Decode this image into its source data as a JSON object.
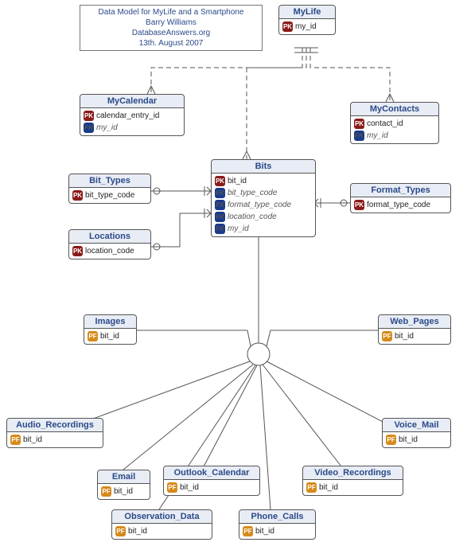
{
  "title": {
    "line1": "Data Model for MyLife and a Smartphone",
    "line2": "Barry Williams",
    "line3": "DatabaseAnswers.org",
    "line4": "13th. August 2007"
  },
  "entities": {
    "MyLife": {
      "name": "MyLife",
      "attrs": [
        {
          "k": "pk",
          "n": "my_id"
        }
      ]
    },
    "MyCalendar": {
      "name": "MyCalendar",
      "attrs": [
        {
          "k": "pk",
          "n": "calendar_entry_id"
        },
        {
          "k": "fk",
          "n": "my_id"
        }
      ]
    },
    "MyContacts": {
      "name": "MyContacts",
      "attrs": [
        {
          "k": "pk",
          "n": "contact_id"
        },
        {
          "k": "fk",
          "n": "my_id"
        }
      ]
    },
    "Bits": {
      "name": "Bits",
      "attrs": [
        {
          "k": "pk",
          "n": "bit_id"
        },
        {
          "k": "fk",
          "n": "bit_type_code"
        },
        {
          "k": "fk",
          "n": "format_type_code"
        },
        {
          "k": "fk",
          "n": "location_code"
        },
        {
          "k": "fk",
          "n": "my_id"
        }
      ]
    },
    "Bit_Types": {
      "name": "Bit_Types",
      "attrs": [
        {
          "k": "pk",
          "n": "bit_type_code"
        }
      ]
    },
    "Format_Types": {
      "name": "Format_Types",
      "attrs": [
        {
          "k": "pk",
          "n": "format_type_code"
        }
      ]
    },
    "Locations": {
      "name": "Locations",
      "attrs": [
        {
          "k": "pk",
          "n": "location_code"
        }
      ]
    },
    "Images": {
      "name": "Images",
      "attrs": [
        {
          "k": "pf",
          "n": "bit_id"
        }
      ]
    },
    "Web_Pages": {
      "name": "Web_Pages",
      "attrs": [
        {
          "k": "pf",
          "n": "bit_id"
        }
      ]
    },
    "Audio_Recordings": {
      "name": "Audio_Recordings",
      "attrs": [
        {
          "k": "pf",
          "n": "bit_id"
        }
      ]
    },
    "Voice_Mail": {
      "name": "Voice_Mail",
      "attrs": [
        {
          "k": "pf",
          "n": "bit_id"
        }
      ]
    },
    "Email": {
      "name": "Email",
      "attrs": [
        {
          "k": "pf",
          "n": "bit_id"
        }
      ]
    },
    "Outlook_Calendar": {
      "name": "Outlook_Calendar",
      "attrs": [
        {
          "k": "pf",
          "n": "bit_id"
        }
      ]
    },
    "Video_Recordings": {
      "name": "Video_Recordings",
      "attrs": [
        {
          "k": "pf",
          "n": "bit_id"
        }
      ]
    },
    "Observation_Data": {
      "name": "Observation_Data",
      "attrs": [
        {
          "k": "pf",
          "n": "bit_id"
        }
      ]
    },
    "Phone_Calls": {
      "name": "Phone_Calls",
      "attrs": [
        {
          "k": "pf",
          "n": "bit_id"
        }
      ]
    }
  },
  "badges": {
    "pk": "PK",
    "fk": "FK",
    "pf": "PF"
  }
}
